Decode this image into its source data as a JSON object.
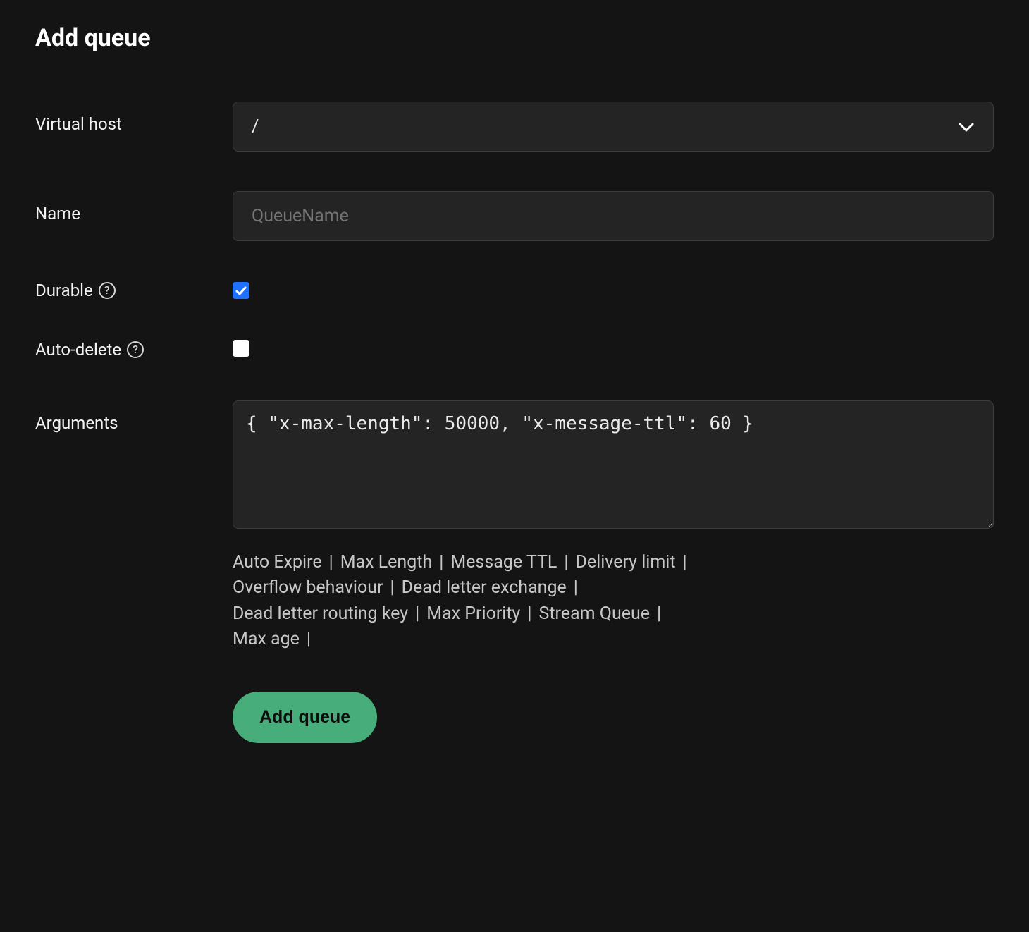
{
  "title": "Add queue",
  "fields": {
    "virtual_host": {
      "label": "Virtual host",
      "value": "/"
    },
    "name": {
      "label": "Name",
      "placeholder": "QueueName",
      "value": ""
    },
    "durable": {
      "label": "Durable",
      "checked": true
    },
    "auto_delete": {
      "label": "Auto-delete",
      "checked": false
    },
    "arguments": {
      "label": "Arguments",
      "value": "{ \"x-max-length\": 50000, \"x-message-ttl\": 60 }"
    }
  },
  "argument_hints": [
    "Auto Expire",
    "Max Length",
    "Message TTL",
    "Delivery limit",
    "Overflow behaviour",
    "Dead letter exchange",
    "Dead letter routing key",
    "Max Priority",
    "Stream Queue",
    "Max age"
  ],
  "submit_label": "Add queue"
}
